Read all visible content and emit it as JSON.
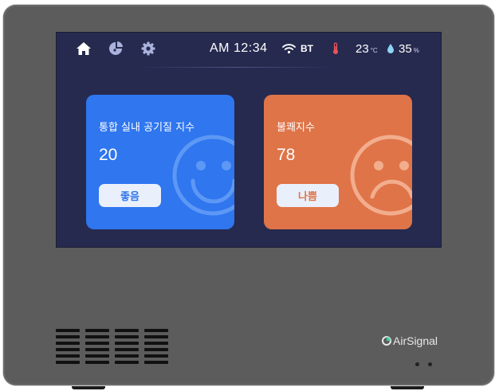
{
  "status_bar": {
    "time": "AM 12:34",
    "connectivity": "BT",
    "temperature_value": "23",
    "temperature_unit": "°C",
    "humidity_value": "35",
    "humidity_unit": "%"
  },
  "nav": {
    "icons": [
      "home-icon",
      "pie-chart-icon",
      "gear-icon"
    ],
    "active": "home-icon"
  },
  "cards": [
    {
      "title": "통합 실내 공기질 지수",
      "value": "20",
      "status": "좋음",
      "mood": "smile",
      "color": "#2f76ef"
    },
    {
      "title": "불쾌지수",
      "value": "78",
      "status": "나쁨",
      "mood": "sad",
      "color": "#df7448"
    }
  ],
  "brand": {
    "name": "AirSignal"
  },
  "colors": {
    "screen_bg": "#262a4f",
    "device_body": "#5c5c5c",
    "good": "#2f76ef",
    "bad": "#df7448"
  }
}
